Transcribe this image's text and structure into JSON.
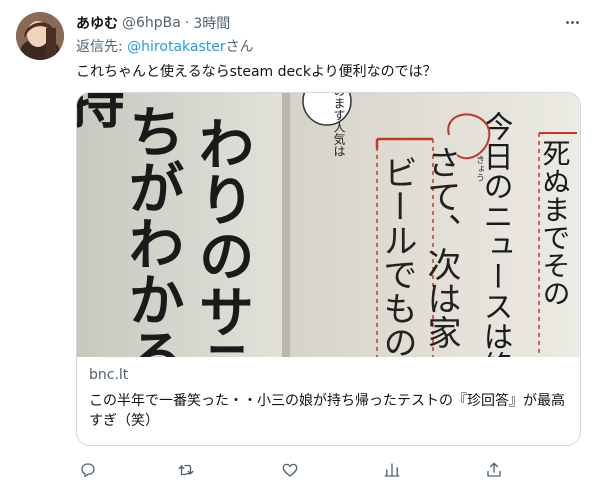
{
  "tweet": {
    "display_name": "あゆむ",
    "handle": "@6hpBa",
    "separator": "·",
    "time": "3時間",
    "reply_prefix": "返信先: ",
    "reply_mention": "@hirotakaster",
    "reply_suffix": "さん",
    "text": "これちゃんと使えるならsteam deckより便利なのでは？"
  },
  "card": {
    "domain": "bnc.lt",
    "title": "この半年で一番笑った・・小三の娘が持ち帰ったテストの『珍回答』が最高すぎ（笑）",
    "image": {
      "left_text_col1": "わりのサラリ",
      "left_text_col2": "ちがわかる",
      "left_text_col3": "持",
      "right_col1": "今日のニュースは終わり",
      "right_col2": "さて、次は家",
      "right_col3": "ビールでものむ",
      "right_col4": "死ぬまでその",
      "ruby": "きょう",
      "bubble_text": "のます人気は"
    }
  },
  "actions": [
    {
      "icon": "reply-icon"
    },
    {
      "icon": "retweet-icon"
    },
    {
      "icon": "like-icon"
    },
    {
      "icon": "analytics-icon"
    },
    {
      "icon": "share-icon"
    }
  ],
  "colors": {
    "accent": "#1d9bf0",
    "secondary_text": "#536471",
    "border": "#cfd9de",
    "correction_red": "#c0392b"
  }
}
